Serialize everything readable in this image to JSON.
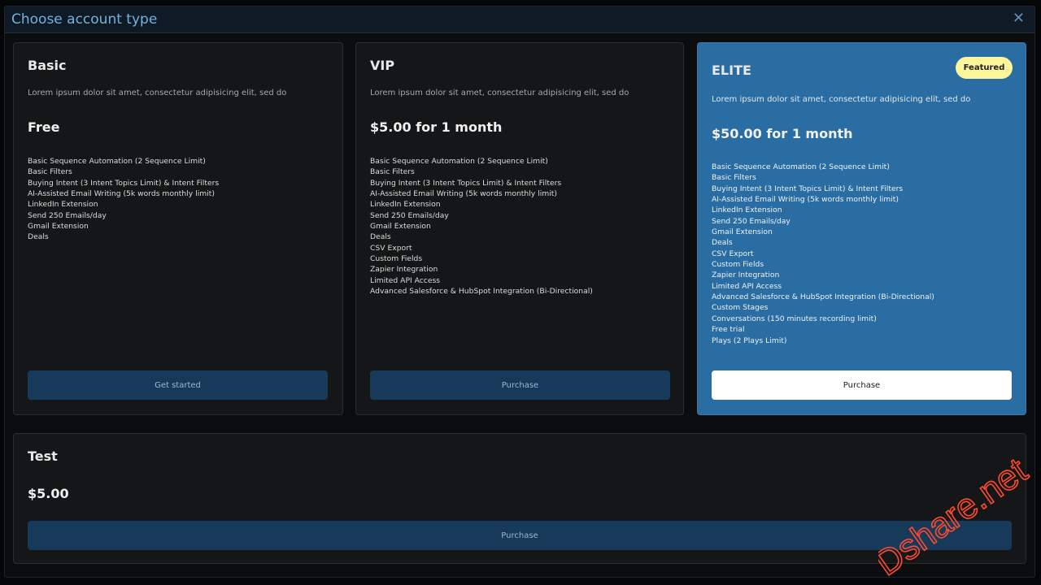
{
  "modal": {
    "title": "Choose account type",
    "close_icon": "close-icon"
  },
  "plans": {
    "basic": {
      "title": "Basic",
      "description": "Lorem ipsum dolor sit amet, consectetur adipisicing elit, sed do",
      "price": "Free",
      "features": [
        "Basic Sequence Automation (2 Sequence Limit)",
        "Basic Filters",
        "Buying Intent (3 Intent Topics Limit) & Intent Filters",
        "AI-Assisted Email Writing (5k words monthly limit)",
        "LinkedIn Extension",
        "Send 250 Emails/day",
        "Gmail Extension",
        "Deals"
      ],
      "button_label": "Get started"
    },
    "vip": {
      "title": "VIP",
      "description": "Lorem ipsum dolor sit amet, consectetur adipisicing elit, sed do",
      "price": "$5.00 for 1 month",
      "features": [
        "Basic Sequence Automation (2 Sequence Limit)",
        "Basic Filters",
        "Buying Intent (3 Intent Topics Limit) & Intent Filters",
        "AI-Assisted Email Writing (5k words monthly limit)",
        "LinkedIn Extension",
        "Send 250 Emails/day",
        "Gmail Extension",
        "Deals",
        "CSV Export",
        "Custom Fields",
        "Zapier Integration",
        "Limited API Access",
        "Advanced Salesforce & HubSpot Integration (Bi-Directional)"
      ],
      "button_label": "Purchase"
    },
    "elite": {
      "title": "ELITE",
      "badge": "Featured",
      "description": "Lorem ipsum dolor sit amet, consectetur adipisicing elit, sed do",
      "price": "$50.00 for 1 month",
      "features": [
        "Basic Sequence Automation (2 Sequence Limit)",
        "Basic Filters",
        "Buying Intent (3 Intent Topics Limit) & Intent Filters",
        "AI-Assisted Email Writing (5k words monthly limit)",
        "LinkedIn Extension",
        "Send 250 Emails/day",
        "Gmail Extension",
        "Deals",
        "CSV Export",
        "Custom Fields",
        "Zapier Integration",
        "Limited API Access",
        "Advanced Salesforce & HubSpot Integration (Bi-Directional)",
        "Custom Stages",
        "Conversations (150 minutes recording limit)",
        "Free trial",
        "Plays (2 Plays Limit)"
      ],
      "button_label": "Purchase"
    },
    "test": {
      "title": "Test",
      "price": "$5.00",
      "button_label": "Purchase"
    }
  },
  "watermark": {
    "text": "Dshare.net"
  },
  "colors": {
    "accent": "#6fb3e0",
    "featured_bg": "#2a6da3",
    "button_bg": "#173a5a",
    "badge_bg": "#fdf59a"
  }
}
